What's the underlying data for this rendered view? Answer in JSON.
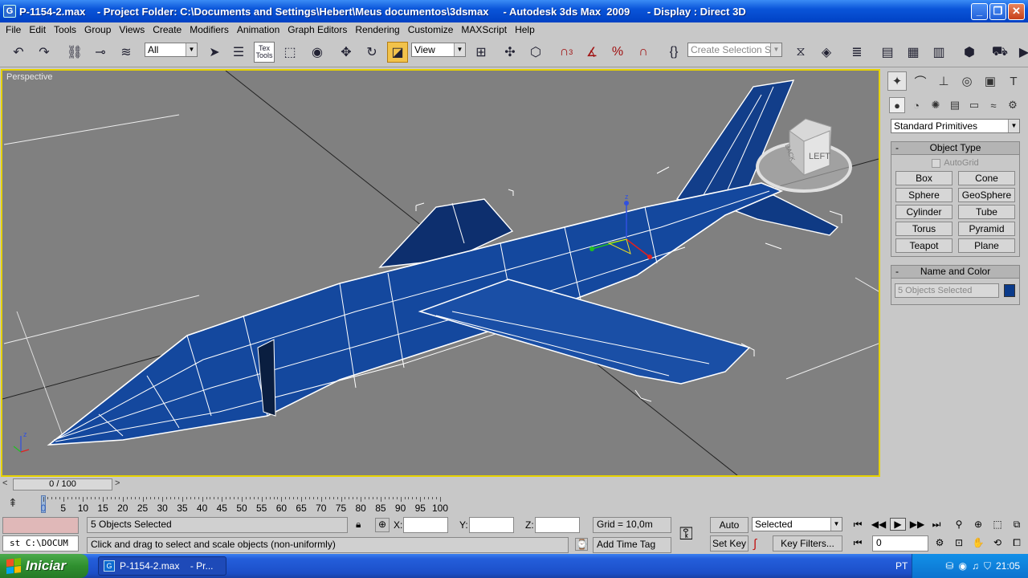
{
  "window": {
    "title": "P-1154-2.max    - Project Folder: C:\\Documents and Settings\\Hebert\\Meus documentos\\3dsmax     - Autodesk 3ds Max  2009      - Display : Direct 3D",
    "app_icon": "G",
    "minimize": "_",
    "maximize": "❐",
    "close": "✕"
  },
  "menu": [
    "File",
    "Edit",
    "Tools",
    "Group",
    "Views",
    "Create",
    "Modifiers",
    "Animation",
    "Graph Editors",
    "Rendering",
    "Customize",
    "MAXScript",
    "Help"
  ],
  "toolbar": {
    "selection_filter": "All",
    "ref_coord": "View",
    "named_selection_placeholder": "Create Selection Set",
    "text_tools_label": "Tex Tools",
    "snap_3": "3"
  },
  "viewport": {
    "label": "Perspective",
    "viewcube_face_left": "LEFT",
    "viewcube_face_back": "BACK",
    "gizmo_axis_z": "z",
    "axis_tripod_z": "z"
  },
  "command_panel": {
    "category": "Standard Primitives",
    "object_type": {
      "title": "Object Type",
      "autogrid": "AutoGrid",
      "buttons": [
        "Box",
        "Cone",
        "Sphere",
        "GeoSphere",
        "Cylinder",
        "Tube",
        "Torus",
        "Pyramid",
        "Teapot",
        "Plane"
      ]
    },
    "name_color": {
      "title": "Name and Color",
      "value": "5 Objects Selected",
      "color": "#0a3a8a"
    }
  },
  "timeline": {
    "frame": "0 / 100",
    "ticks": [
      "0",
      "5",
      "10",
      "15",
      "20",
      "25",
      "30",
      "35",
      "40",
      "45",
      "50",
      "55",
      "60",
      "65",
      "70",
      "75",
      "80",
      "85",
      "90",
      "95",
      "100"
    ]
  },
  "status": {
    "selection": "5 Objects Selected",
    "prompt": "Click and drag to select and scale objects (non-uniformly)",
    "maxscript": "st C:\\DOCUM",
    "x_label": "X:",
    "y_label": "Y:",
    "z_label": "Z:",
    "x_value": "",
    "y_value": "",
    "z_value": "",
    "grid": "Grid = 10,0m",
    "add_time_tag": "Add Time Tag",
    "auto_key": "Auto Key",
    "set_key": "Set Key",
    "key_mode": "Selected",
    "key_filters": "Key Filters...",
    "frame_value": "0"
  },
  "taskbar": {
    "start": "Iniciar",
    "task_label": "P-1154-2.max    - Pr...",
    "lang": "PT",
    "clock": "21:05"
  }
}
